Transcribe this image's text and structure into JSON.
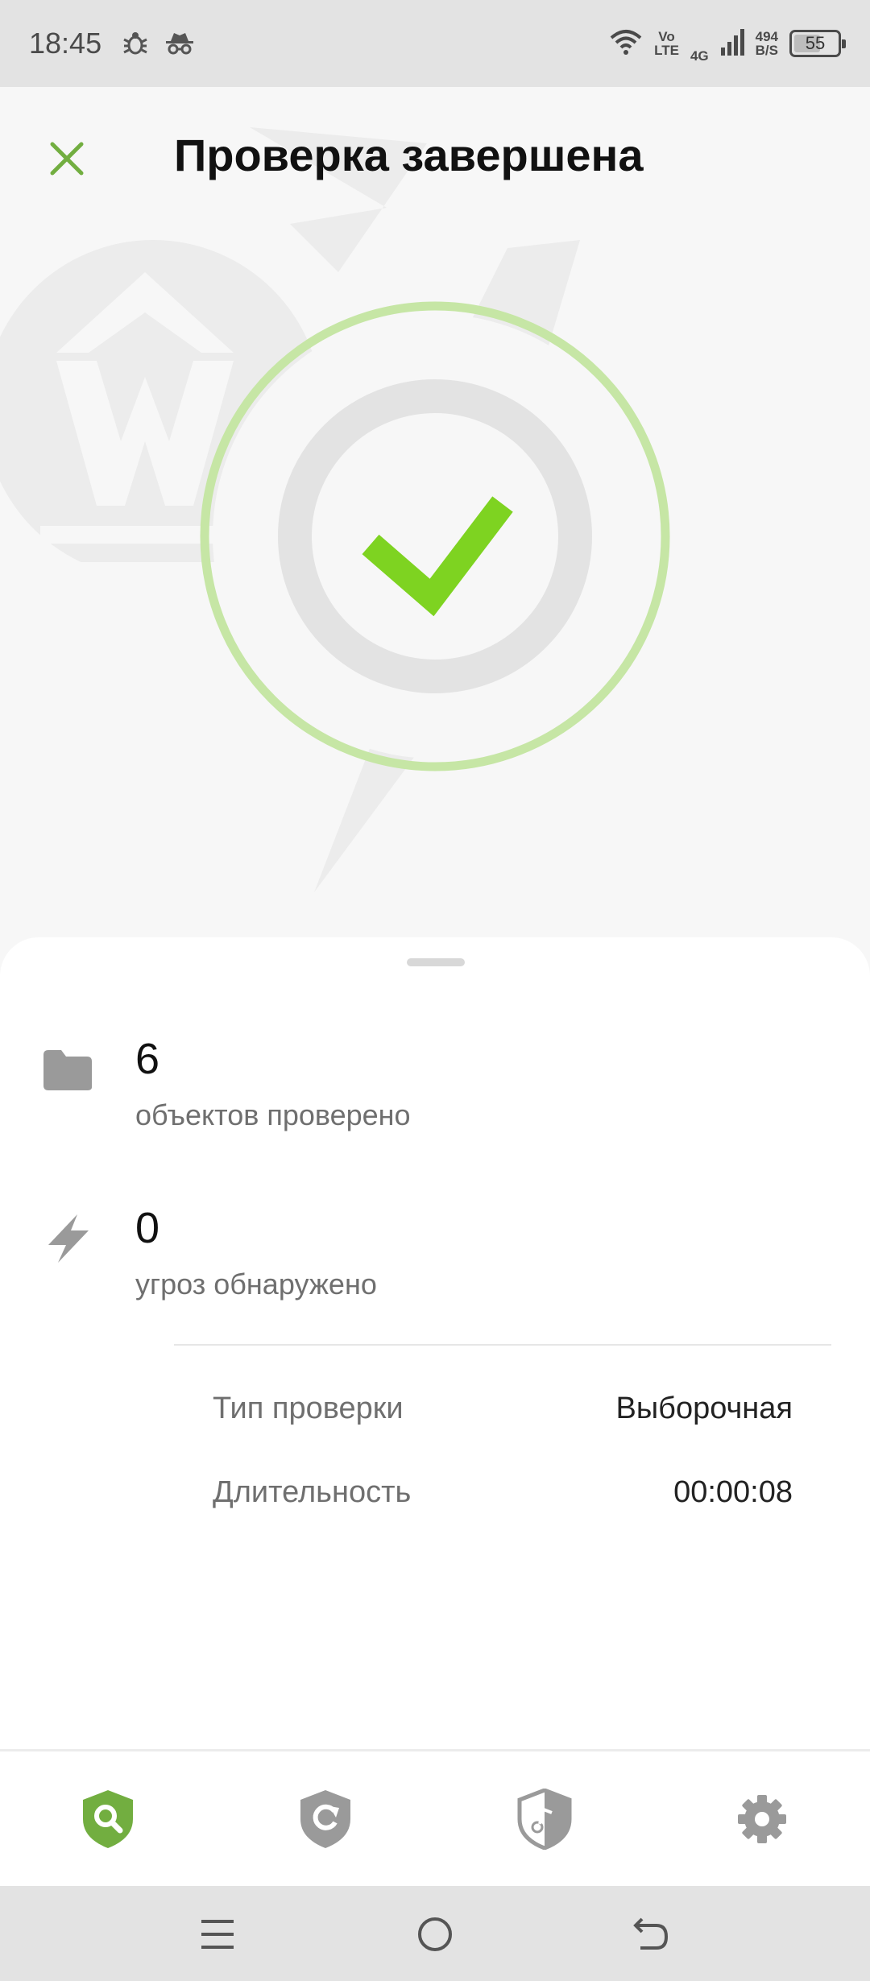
{
  "status_bar": {
    "time": "18:45",
    "left_icons": [
      "bug-icon",
      "incognito-icon"
    ],
    "volte_top": "Vo",
    "volte_bottom": "LTE",
    "network": "4G",
    "speed_value": "494",
    "speed_unit": "B/S",
    "battery": "55"
  },
  "header": {
    "title": "Проверка завершена",
    "close_icon": "close-icon"
  },
  "hero": {
    "status_icon": "checkmark-icon",
    "accent_color": "#7ed321",
    "ring_color": "#c6e6a5"
  },
  "results": {
    "scanned": {
      "value": "6",
      "label": "объектов проверено",
      "icon": "folder-icon"
    },
    "threats": {
      "value": "0",
      "label": "угроз обнаружено",
      "icon": "lightning-icon"
    }
  },
  "details": [
    {
      "label": "Тип проверки",
      "value": "Выборочная"
    },
    {
      "label": "Длительность",
      "value": "00:00:08"
    }
  ],
  "bottom_nav": {
    "items": [
      {
        "icon": "shield-search-icon",
        "active": true
      },
      {
        "icon": "shield-update-icon",
        "active": false
      },
      {
        "icon": "shield-firewall-icon",
        "active": false
      },
      {
        "icon": "gear-icon",
        "active": false
      }
    ],
    "active_color": "#72ae40",
    "inactive_color": "#9a9a9a"
  },
  "system_nav": {
    "items": [
      "menu-icon",
      "home-icon",
      "back-icon"
    ]
  }
}
